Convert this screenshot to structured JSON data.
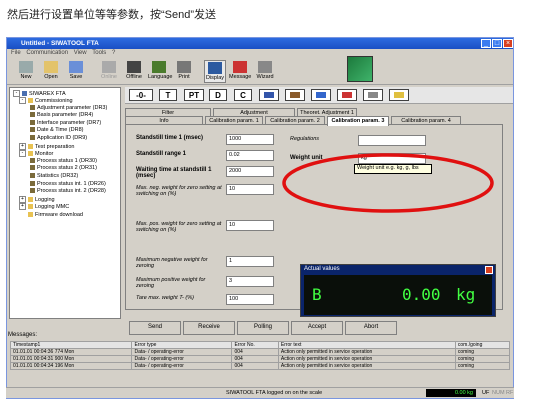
{
  "caption": "然后进行设置单位等等参数，按“Send”发送",
  "window": {
    "title": "Untitled - SIWATOOL FTA"
  },
  "menu": [
    "File",
    "Communication",
    "View",
    "Tools",
    "?"
  ],
  "toolbar": [
    "New",
    "Open",
    "Save",
    "Online",
    "Offline",
    "Language",
    "Print",
    "Display",
    "Message",
    "Wizard"
  ],
  "tree": {
    "root": "SIWAREX FTA",
    "items": [
      {
        "label": "Commissioning",
        "level": 1,
        "expander": "-",
        "icon": "folder"
      },
      {
        "label": "Adjustment parameter (DR3)",
        "level": 2,
        "icon": "tool"
      },
      {
        "label": "Basis parameter (DR4)",
        "level": 2,
        "icon": "tool"
      },
      {
        "label": "Interface parameter (DR7)",
        "level": 2,
        "icon": "tool"
      },
      {
        "label": "Date & Time (DR8)",
        "level": 2,
        "icon": "tool"
      },
      {
        "label": "Application ID (DR9)",
        "level": 2,
        "icon": "tool"
      },
      {
        "label": "Test preparation",
        "level": 1,
        "expander": "+",
        "icon": "folder"
      },
      {
        "label": "Monitor",
        "level": 1,
        "expander": "-",
        "icon": "folder"
      },
      {
        "label": "Process status 1 (DR30)",
        "level": 2,
        "icon": "tool"
      },
      {
        "label": "Process status 2 (DR31)",
        "level": 2,
        "icon": "tool"
      },
      {
        "label": "Statistics (DR32)",
        "level": 2,
        "icon": "tool"
      },
      {
        "label": "Process status int. 1 (DR26)",
        "level": 2,
        "icon": "tool"
      },
      {
        "label": "Process status int. 2 (DR28)",
        "level": 2,
        "icon": "tool"
      },
      {
        "label": "Logging",
        "level": 1,
        "expander": "+",
        "icon": "folder"
      },
      {
        "label": "Logging MMC",
        "level": 1,
        "expander": "+",
        "icon": "folder"
      },
      {
        "label": "Firmware download",
        "level": 1,
        "expander": "",
        "icon": "folder"
      }
    ]
  },
  "commands": [
    "-0-",
    "T",
    "PT",
    "D",
    "C"
  ],
  "tabs_row1": [
    "Filter",
    "Adjustment",
    "Theoret. Adjustment 1"
  ],
  "tabs_row2": [
    "Info",
    "Calibration param. 1",
    "Calibration param. 2",
    "Calibration param. 3",
    "Calibration param. 4"
  ],
  "fields": [
    {
      "label": "Standstill time 1 (msec)",
      "value": "1000",
      "style": "b"
    },
    {
      "label": "Standstill range 1",
      "value": "0.02",
      "style": "b"
    },
    {
      "label": "Waiting time at standstill 1 (msec)",
      "value": "2000",
      "style": "b"
    },
    {
      "label": "Max. neg. weight for zero setting at switching on (%)",
      "value": "10",
      "style": "i"
    },
    {
      "label": "Max. pos. weight for zero setting at switching on (%)",
      "value": "10",
      "style": "i"
    },
    {
      "label": "Maximum negative weight for zeroing",
      "value": "1",
      "style": "i"
    },
    {
      "label": "Maximum positive weight for zeroing",
      "value": "3",
      "style": "i"
    },
    {
      "label": "Tare max. weight T- (%)",
      "value": "100",
      "style": "i"
    }
  ],
  "regulations": {
    "label": "Regulations",
    "value": ""
  },
  "weight_unit": {
    "label": "Weight unit",
    "value": "kg",
    "tooltip": "Weight unit e.g. kg, g, lbs"
  },
  "buttons": [
    "Send",
    "Receive",
    "Polling",
    "Accept",
    "Abort"
  ],
  "actual": {
    "title": "Actual values",
    "status": "B",
    "value": "0.00",
    "unit": "kg"
  },
  "messages": {
    "title": "Messages:",
    "columns": [
      "Timestamp1",
      "Error type",
      "Error No.",
      "Error text",
      "com./going"
    ],
    "rows": [
      [
        "01.01.01 00:04:36 774 Mon",
        "Data- / operating-error",
        "004",
        "Action only permitted in service operation",
        "coming"
      ],
      [
        "01.01.01 00:04:31 900 Mon",
        "Data- / operating-error",
        "004",
        "Action only permitted in service operation",
        "coming"
      ],
      [
        "01.01.01 00:04:34 196 Mon",
        "Data- / operating-error",
        "004",
        "Action only permitted in service operation",
        "coming"
      ]
    ]
  },
  "status": {
    "text": "SIWATOOL FTA logged on on the scale",
    "value": "0.00 kg",
    "flags": [
      "UF",
      "NUM",
      "RF"
    ]
  },
  "colors": {
    "accent": "#0a246a",
    "oval": "#e01010",
    "display_text": "#42ff42"
  }
}
